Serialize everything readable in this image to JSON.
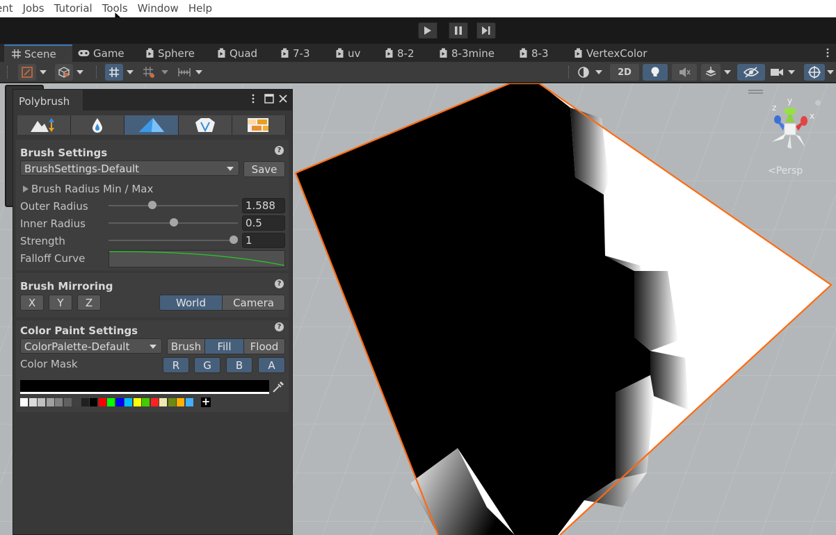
{
  "menubar": {
    "items": [
      "ent",
      "Jobs",
      "Tutorial",
      "Tools",
      "Window",
      "Help"
    ]
  },
  "tabs": [
    {
      "label": "Scene",
      "icon": "scene-grid-icon",
      "active": true
    },
    {
      "label": "Game",
      "icon": "gamepad-icon"
    },
    {
      "label": "Sphere",
      "icon": "scene-doc-icon"
    },
    {
      "label": "Quad",
      "icon": "scene-doc-icon"
    },
    {
      "label": "7-3",
      "icon": "scene-doc-icon"
    },
    {
      "label": "uv",
      "icon": "scene-doc-icon"
    },
    {
      "label": "8-2",
      "icon": "scene-doc-icon"
    },
    {
      "label": "8-3mine",
      "icon": "scene-doc-icon"
    },
    {
      "label": "8-3",
      "icon": "scene-doc-icon"
    },
    {
      "label": "VertexColor",
      "icon": "scene-doc-icon"
    }
  ],
  "toolbar": {
    "toggle_2d": "2D"
  },
  "gizmo": {
    "persp_label": "Persp",
    "axes": {
      "x": "x",
      "y": "y",
      "z": "z"
    }
  },
  "polybrush": {
    "title": "Polybrush",
    "modes": [
      "sculpt-icon",
      "smooth-icon",
      "paint-vertex-icon",
      "prefab-icon",
      "texture-icon"
    ],
    "active_mode": 2,
    "brush_settings": {
      "title": "Brush Settings",
      "preset": "BrushSettings-Default",
      "save_label": "Save",
      "radius_foldout": "Brush Radius Min / Max",
      "outer_radius": {
        "label": "Outer Radius",
        "value": "1.588",
        "fraction": 0.34
      },
      "inner_radius": {
        "label": "Inner Radius",
        "value": "0.5",
        "fraction": 0.5
      },
      "strength": {
        "label": "Strength",
        "value": "1",
        "fraction": 1.0
      },
      "falloff": {
        "label": "Falloff Curve",
        "curve_color": "#25c925"
      }
    },
    "mirroring": {
      "title": "Brush Mirroring",
      "axes": [
        "X",
        "Y",
        "Z"
      ],
      "spaces": [
        "World",
        "Camera"
      ],
      "active_space": "World"
    },
    "color_paint": {
      "title": "Color Paint Settings",
      "palette": "ColorPalette-Default",
      "modes": [
        "Brush",
        "Fill",
        "Flood"
      ],
      "active_mode": "Fill",
      "mask_label": "Color Mask",
      "mask_channels": [
        "R",
        "G",
        "B",
        "A"
      ],
      "current_color": "#000000",
      "swatches": [
        "#ffffff",
        "#dcdcdc",
        "#c0c0c0",
        "#a0a0a0",
        "#808080",
        "#606060",
        "#404040",
        "#202020",
        "#000000",
        "#ff0000",
        "#00ff00",
        "#0000ff",
        "#00bfff",
        "#ffff00",
        "#44cc00",
        "#ff2222",
        "#f0e8b0",
        "#6e8a10",
        "#ffb000",
        "#40b0ff"
      ],
      "add_label": "+"
    }
  },
  "scene": {
    "selection_outline_color": "#ff6a10",
    "background": "#b3b7b9"
  }
}
